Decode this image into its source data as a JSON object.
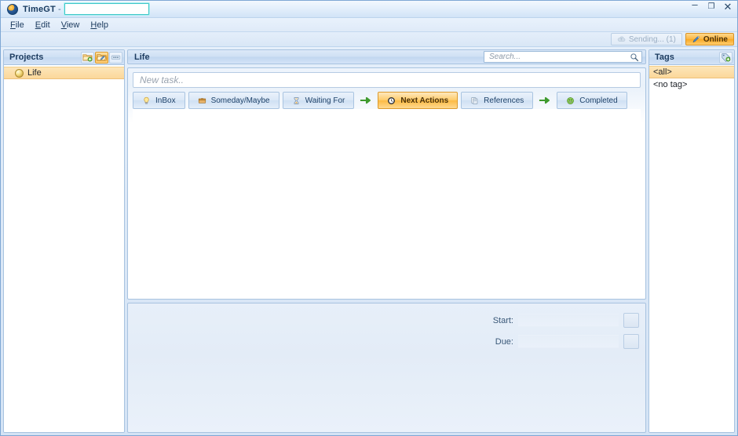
{
  "window": {
    "app_name": "TimeGT",
    "title_separator": "-",
    "rename_field_value": "",
    "controls": {
      "minimize": "–",
      "maximize": "❐",
      "close": "✕"
    }
  },
  "menubar": {
    "items": [
      {
        "label": "File",
        "accel": "F",
        "rest": "ile"
      },
      {
        "label": "Edit",
        "accel": "E",
        "rest": "dit"
      },
      {
        "label": "View",
        "accel": "V",
        "rest": "iew"
      },
      {
        "label": "Help",
        "accel": "H",
        "rest": "elp"
      }
    ]
  },
  "topstrip": {
    "sending": {
      "label": "Sending... (1)",
      "icon": "cloud-upload-icon",
      "enabled": false
    },
    "online": {
      "label": "Online",
      "icon": "pen-icon",
      "accent": "#f9a925"
    }
  },
  "projects": {
    "title": "Projects",
    "buttons": [
      {
        "name": "add-project-icon",
        "active": false
      },
      {
        "name": "edit-project-icon",
        "active": true
      },
      {
        "name": "project-options-icon",
        "active": false
      }
    ],
    "items": [
      {
        "label": "Life",
        "icon": "project-sphere-icon",
        "selected": true
      }
    ]
  },
  "center": {
    "header_title": "Life",
    "search": {
      "placeholder": "Search...",
      "value": "",
      "icon": "search-icon"
    },
    "new_task": {
      "placeholder": "New task..",
      "value": ""
    },
    "tabs": [
      {
        "label": "InBox",
        "icon": "lightbulb-icon",
        "active": false
      },
      {
        "label": "Someday/Maybe",
        "icon": "box-icon",
        "active": false
      },
      {
        "label": "Waiting For",
        "icon": "hourglass-icon",
        "active": false
      },
      {
        "label": "Next Actions",
        "icon": "clock-icon",
        "active": true
      },
      {
        "label": "References",
        "icon": "pages-icon",
        "active": false
      },
      {
        "label": "Completed",
        "icon": "smiley-icon",
        "active": false
      }
    ],
    "tab_arrows": [
      {
        "name": "flow-arrow-1",
        "after_tab": "Waiting For"
      },
      {
        "name": "flow-arrow-2",
        "after_tab": "References"
      }
    ],
    "task_rows": []
  },
  "detail": {
    "start": {
      "label": "Start:",
      "value": ""
    },
    "due": {
      "label": "Due:",
      "value": ""
    },
    "picker_icon": "calendar-picker-icon"
  },
  "tags": {
    "title": "Tags",
    "add_button": "add-tag-icon",
    "items": [
      {
        "label": "<all>",
        "selected": true
      },
      {
        "label": "<no tag>",
        "selected": false
      }
    ]
  },
  "colors": {
    "accent_orange": "#f9a925",
    "panel_blue": "#cfe0f4",
    "border_blue": "#a8c3e0",
    "text_dark": "#1d3c60"
  }
}
